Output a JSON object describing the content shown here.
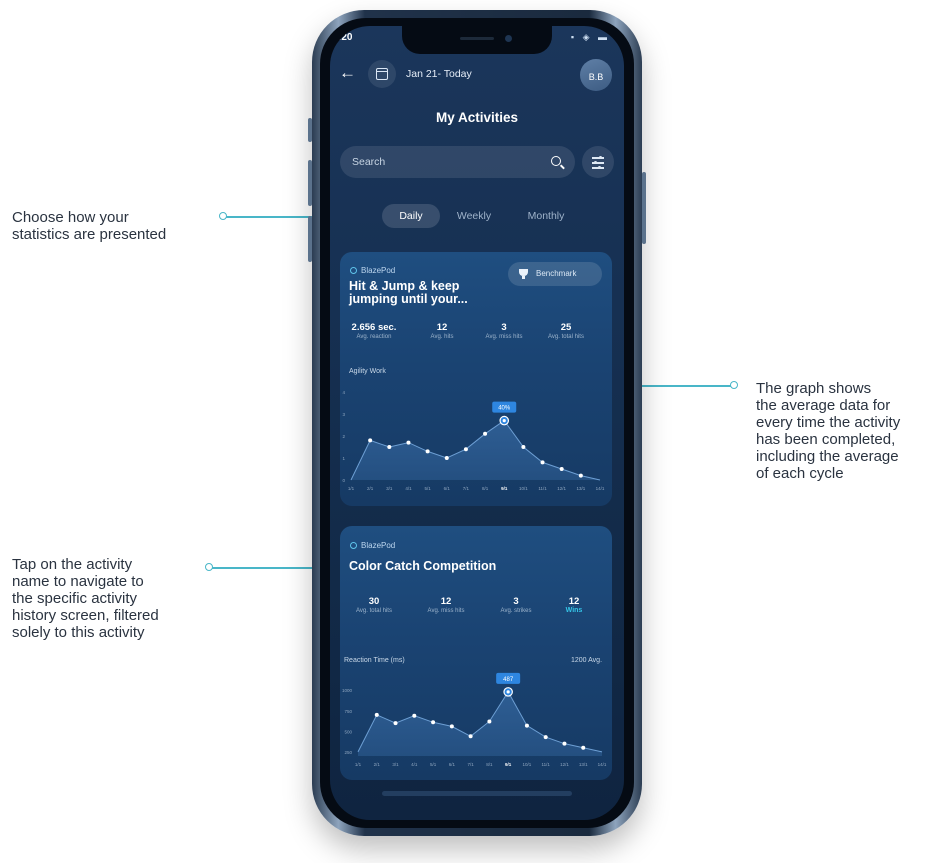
{
  "callouts": {
    "left_top": [
      "Choose how your",
      "statistics are presented"
    ],
    "right": [
      "The graph shows",
      "the average data for",
      "every time the activity",
      "has been completed,",
      "including the average",
      "of each cycle"
    ],
    "left_bottom": [
      "Tap on the activity",
      "name to navigate to",
      "the specific activity",
      "history screen, filtered",
      "solely to this activity"
    ]
  },
  "status_bar": {
    "time": ":20",
    "icons": "▪ ◈ ▬"
  },
  "header": {
    "back_icon": "arrow-left-icon",
    "date_range": "Jan 21- Today",
    "avatar_initials": "B.B",
    "title": "My Activities"
  },
  "search": {
    "placeholder": "Search"
  },
  "tabs": [
    {
      "label": "Daily",
      "active": true
    },
    {
      "label": "Weekly",
      "active": false
    },
    {
      "label": "Monthly",
      "active": false
    }
  ],
  "activities": [
    {
      "brand": "BlazePod",
      "title_lines": [
        "Hit & Jump & keep",
        "jumping until your..."
      ],
      "benchmark_label": "Benchmark",
      "stats": [
        {
          "value": "2.656 sec.",
          "label": "Avg. reaction"
        },
        {
          "value": "12",
          "label": "Avg. hits"
        },
        {
          "value": "3",
          "label": "Avg. miss hits"
        },
        {
          "value": "25",
          "label": "Avg. total hits"
        }
      ]
    },
    {
      "brand": "BlazePod",
      "title": "Color Catch Competition",
      "stats": [
        {
          "value": "30",
          "label": "Avg. total hits"
        },
        {
          "value": "12",
          "label": "Avg. miss hits"
        },
        {
          "value": "3",
          "label": "Avg. strikes"
        },
        {
          "value": "12",
          "label": "Wins"
        }
      ]
    }
  ],
  "chart_data": [
    {
      "type": "area",
      "title": "Agility Work",
      "x": [
        "1/1",
        "2/1",
        "3/1",
        "4/1",
        "5/1",
        "6/1",
        "7/1",
        "8/1",
        "9/1",
        "10/1",
        "11/1",
        "12/1",
        "13/1",
        "14/1"
      ],
      "values": [
        0,
        1.8,
        1.5,
        1.7,
        1.3,
        1.0,
        1.4,
        2.1,
        2.7,
        1.5,
        0.8,
        0.5,
        0.2,
        0
      ],
      "highlight": {
        "x": "9/1",
        "label": "40%"
      },
      "yticks": [
        0,
        1,
        2,
        3,
        4
      ],
      "ylim": [
        0,
        4
      ],
      "colors": {
        "fill": "#2f5f95",
        "line": "#6d9fd4",
        "point": "#ffffff",
        "highlight": "#2e86e0"
      }
    },
    {
      "type": "area",
      "title": "Reaction Time (ms)",
      "annotation": "1200 Avg.",
      "x": [
        "1/1",
        "2/1",
        "3/1",
        "4/1",
        "5/1",
        "6/1",
        "7/1",
        "8/1",
        "9/1",
        "10/1",
        "11/1",
        "12/1",
        "13/1",
        "14/1"
      ],
      "values": [
        250,
        700,
        600,
        690,
        610,
        560,
        440,
        620,
        980,
        570,
        430,
        350,
        300,
        250
      ],
      "highlight": {
        "x": "9/1",
        "label": "487"
      },
      "yticks": [
        250,
        500,
        750,
        1000
      ],
      "ylim": [
        200,
        1100
      ],
      "colors": {
        "fill": "#2f5f95",
        "line": "#6d9fd4",
        "point": "#ffffff",
        "highlight": "#2e86e0"
      }
    }
  ]
}
